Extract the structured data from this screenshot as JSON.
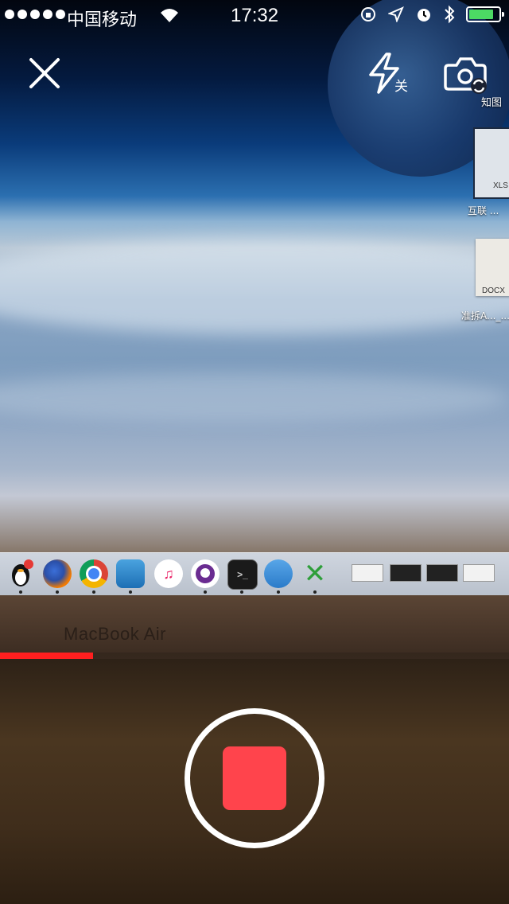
{
  "status_bar": {
    "carrier": "中国移动",
    "time": "17:32",
    "battery_level": 0.85,
    "battery_color": "#4cd964"
  },
  "top_controls": {
    "close_icon": "close-icon",
    "flash_icon": "flash-icon",
    "flash_state": "关",
    "switch_camera_icon": "switch-camera-icon"
  },
  "viewfinder": {
    "desktop_files": [
      {
        "label": "知图",
        "ext": ""
      },
      {
        "label": "互联 ...",
        "ext": "XLS"
      },
      {
        "label": "准拆A..._...",
        "ext": "DOCX"
      }
    ],
    "laptop_label": "MacBook Air"
  },
  "recording": {
    "progress": 0.183,
    "progress_color": "#ff1f1f",
    "stop_color": "#ff444c"
  }
}
